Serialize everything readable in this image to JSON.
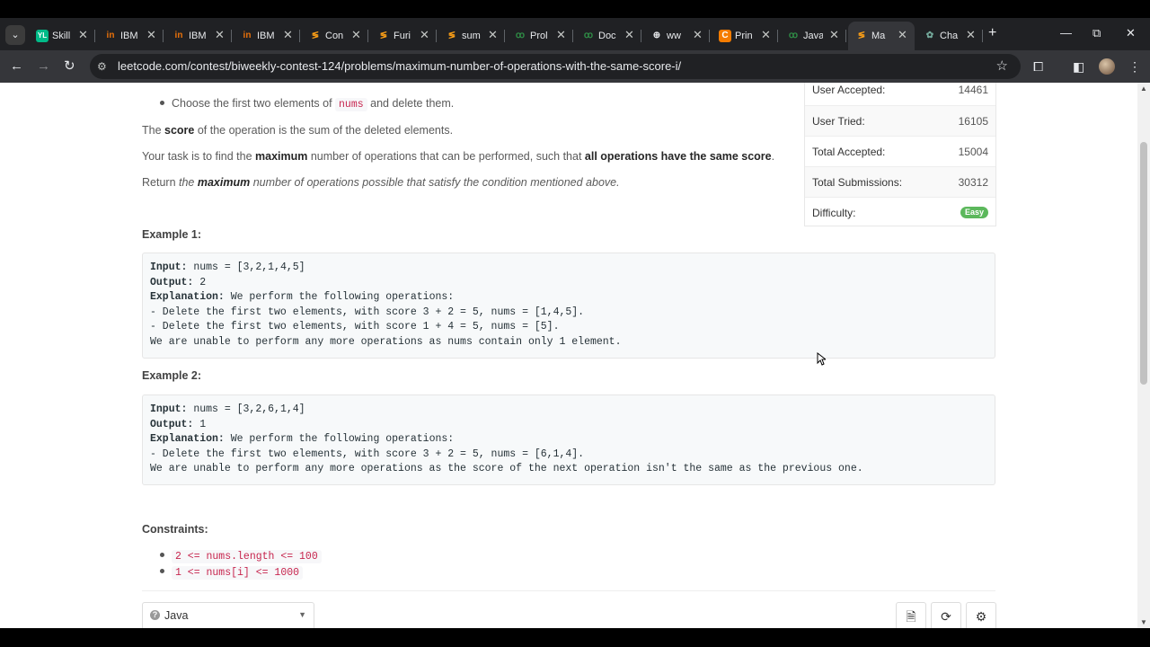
{
  "browser": {
    "tabs": [
      {
        "title": "Skill",
        "icon": "YL",
        "icon_color": "#1a73e8"
      },
      {
        "title": "IBM",
        "icon": "in",
        "icon_color": "#e8710a"
      },
      {
        "title": "IBM",
        "icon": "in",
        "icon_color": "#e8710a"
      },
      {
        "title": "IBM",
        "icon": "in",
        "icon_color": "#e8710a"
      },
      {
        "title": "Con",
        "icon": "≶",
        "icon_color": "#ffa116"
      },
      {
        "title": "Furi",
        "icon": "≶",
        "icon_color": "#ffa116"
      },
      {
        "title": "sum",
        "icon": "≶",
        "icon_color": "#ffa116"
      },
      {
        "title": "Prol",
        "icon": "gfg",
        "icon_color": "#2f8d46"
      },
      {
        "title": "Doc",
        "icon": "gfg",
        "icon_color": "#2f8d46"
      },
      {
        "title": "ww",
        "icon": "globe",
        "icon_color": "#e8eaed"
      },
      {
        "title": "Prin",
        "icon": "C",
        "icon_color": "#f57c00"
      },
      {
        "title": "Java",
        "icon": "gfg",
        "icon_color": "#2f8d46"
      },
      {
        "title": "Ma",
        "icon": "≶",
        "icon_color": "#ffa116",
        "active": true
      },
      {
        "title": "Cha",
        "icon": "✿",
        "icon_color": "#74aa9c"
      }
    ],
    "url": "leetcode.com/contest/biweekly-contest-124/problems/maximum-number-of-operations-with-the-same-score-i/",
    "icons": {
      "tab_search": "chevron-down-icon",
      "new_tab": "+",
      "minimize": "—",
      "maximize": "⧉",
      "close": "✕",
      "back": "←",
      "forward": "→",
      "reload": "↻",
      "star": "☆",
      "extensions": "⧠",
      "sidebar": "◧",
      "menu": "⋮",
      "tune": "⚙"
    }
  },
  "problem": {
    "bullet_prefix": "Choose the first two elements of ",
    "bullet_code": "nums",
    "bullet_suffix": " and delete them.",
    "score_the": "The ",
    "score_bold": "score",
    "score_rest": " of the operation is the sum of the deleted elements.",
    "task_pre": "Your task is to find the ",
    "task_bold1": "maximum",
    "task_mid": " number of operations that can be performed, such that ",
    "task_bold2": "all operations have the same score",
    "task_end": ".",
    "return_pre": "Return ",
    "return_the": "the ",
    "return_bold": "maximum",
    "return_rest": " number of operations possible that satisfy the condition mentioned above.",
    "example1_title": "Example 1:",
    "example1": {
      "input_label": "Input:",
      "input": " nums = [3,2,1,4,5]",
      "output_label": "Output:",
      "output": " 2",
      "explanation_label": "Explanation:",
      "explanation": " We perform the following operations:",
      "line1": "- Delete the first two elements, with score 3 + 2 = 5, nums = [1,4,5].",
      "line2": "- Delete the first two elements, with score 1 + 4 = 5, nums = [5].",
      "line3": "We are unable to perform any more operations as nums contain only 1 element."
    },
    "example2_title": "Example 2:",
    "example2": {
      "input_label": "Input:",
      "input": " nums = [3,2,6,1,4]",
      "output_label": "Output:",
      "output": " 1",
      "explanation_label": "Explanation:",
      "explanation": " We perform the following operations:",
      "line1": "- Delete the first two elements, with score 3 + 2 = 5, nums = [6,1,4].",
      "line2": "We are unable to perform any more operations as the score of the next operation isn't the same as the previous one."
    },
    "constraints_title": "Constraints:",
    "constraints": [
      "2 <= nums.length <= 100",
      "1 <= nums[i] <= 1000"
    ]
  },
  "stats": {
    "rows": [
      {
        "label": "User Accepted:",
        "value": "14461"
      },
      {
        "label": "User Tried:",
        "value": "16105"
      },
      {
        "label": "Total Accepted:",
        "value": "15004"
      },
      {
        "label": "Total Submissions:",
        "value": "30312"
      },
      {
        "label": "Difficulty:",
        "value": "Easy"
      }
    ],
    "easy_color": "#5cb85c"
  },
  "editor": {
    "language": "Java",
    "buttons": [
      "file-icon",
      "reset-icon",
      "settings-icon"
    ]
  }
}
